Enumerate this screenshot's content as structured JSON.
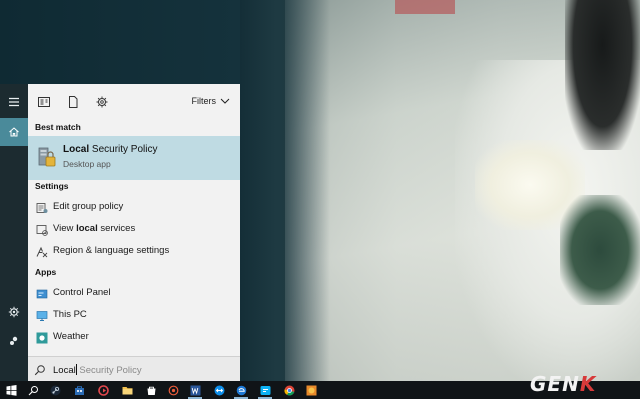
{
  "start_rail": {
    "icons": [
      "hamburger-icon",
      "home-icon",
      "settings-icon",
      "user-icon"
    ]
  },
  "filter_bar": {
    "icons": [
      "all-icon",
      "documents-icon",
      "settings-icon"
    ],
    "filters_label": "Filters"
  },
  "best_match": {
    "heading": "Best match",
    "title_bold": "Local",
    "title_rest": " Security Policy",
    "subtitle": "Desktop app",
    "icon": "local-security-policy-icon"
  },
  "settings_section": {
    "heading": "Settings",
    "items": [
      {
        "bold": "",
        "label": "Edit group policy",
        "rest": "",
        "icon": "group-policy-icon"
      },
      {
        "bold": "local",
        "label": "View ",
        "rest": " services",
        "icon": "services-icon"
      },
      {
        "bold": "",
        "label": "Region & language settings",
        "rest": "",
        "icon": "region-language-icon"
      }
    ]
  },
  "apps_section": {
    "heading": "Apps",
    "items": [
      {
        "label": "Control Panel",
        "icon": "control-panel-icon"
      },
      {
        "label": "This PC",
        "icon": "this-pc-icon"
      },
      {
        "label": "Weather",
        "icon": "weather-icon"
      }
    ]
  },
  "search": {
    "typed": "Local",
    "suggestion": " Security Policy"
  },
  "taskbar": {
    "items": [
      "windows-start-icon",
      "search-icon",
      "steam-icon",
      "store-icon",
      "ccleaner-icon",
      "word-icon",
      "teamviewer-icon",
      "explorer-icon",
      "store2-icon",
      "chrome-icon",
      "word2-icon",
      "firefox-icon"
    ]
  },
  "watermark": {
    "main": "GEN",
    "accent": "K"
  },
  "colors": {
    "accent": "#4a8a9a",
    "selected_row": "#bfdbe3",
    "panel_bg": "#f2f2f2",
    "rail_bg": "#1c2b30",
    "taskbar_bg": "#101417"
  }
}
